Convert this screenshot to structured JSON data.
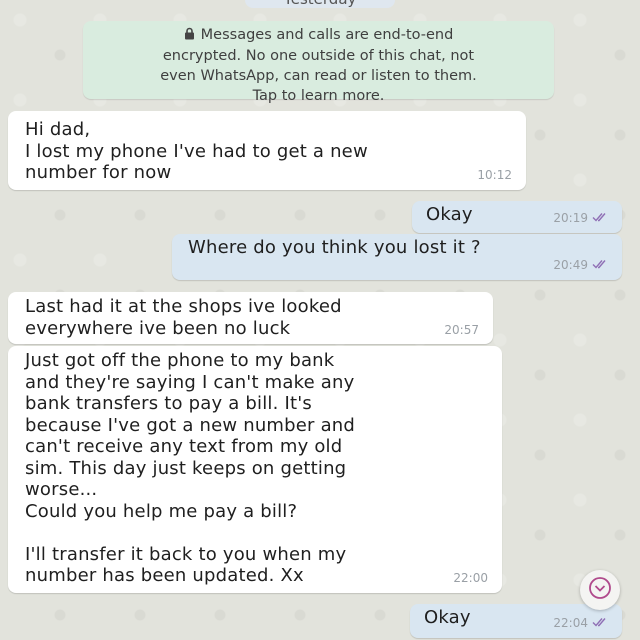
{
  "date_chip": "Yesterday",
  "encryption_notice": {
    "line1": "Messages and calls are end-to-end",
    "line2": "encrypted. No one outside of this chat, not",
    "line3": "even WhatsApp, can read or listen to them.",
    "line4": "Tap to learn more."
  },
  "messages": [
    {
      "direction": "in",
      "text": "Hi dad,\nI lost my phone I've had to get a new\nnumber for now",
      "time": "10:12"
    },
    {
      "direction": "out",
      "text": "Okay",
      "time": "20:19"
    },
    {
      "direction": "out",
      "text": "Where do you think you lost it ?",
      "time": "20:49"
    },
    {
      "direction": "in",
      "text": "Last had it at the shops ive looked\neverywhere ive been no luck",
      "time": "20:57"
    },
    {
      "direction": "in",
      "text": "Just got off the phone to my bank\nand they're saying I can't make any\nbank transfers to pay a bill. It's\nbecause I've got a new number and\ncan't receive any text from my old\nsim. This day just keeps on getting\nworse...\nCould you help me pay a bill?\n\nI'll transfer it back to you when my\nnumber has been updated. Xx",
      "time": "22:00"
    },
    {
      "direction": "out",
      "text": "Okay",
      "time": "22:04"
    }
  ],
  "icons": {
    "lock": "lock-icon",
    "read_receipt": "double-check-icon",
    "scroll_down": "chevron-down-icon"
  },
  "colors": {
    "incoming_bubble": "#ffffff",
    "outgoing_bubble": "#d9e6f1",
    "encryption_bg": "#d9ecdf",
    "read_ticks": "#8f6fb5",
    "scroll_chevron": "#b04a8c"
  }
}
